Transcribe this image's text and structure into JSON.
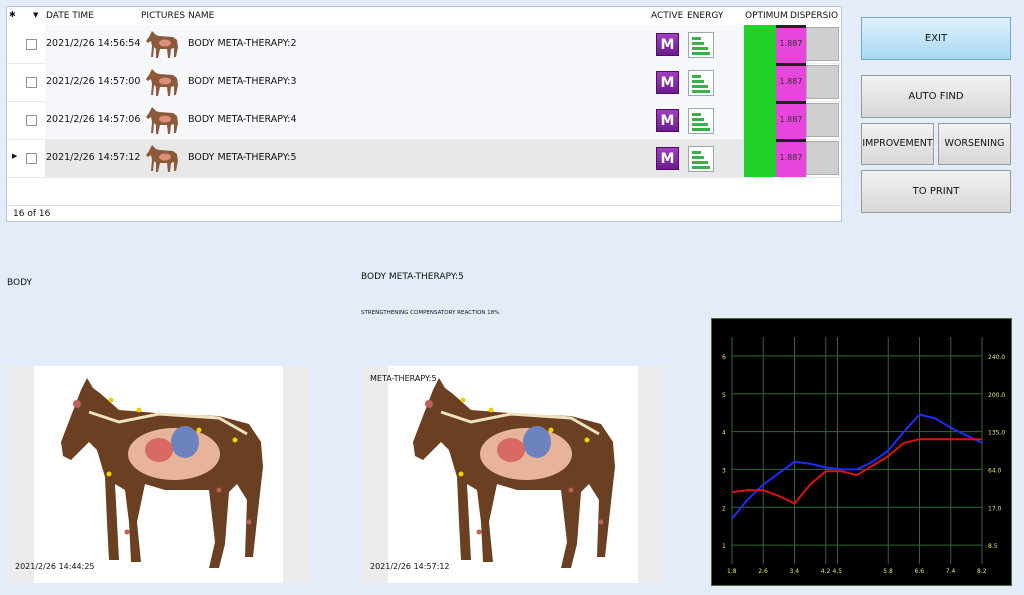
{
  "grid": {
    "headers": {
      "date_time": "DATE TIME",
      "pictures": "PICTURES",
      "name": "NAME",
      "active": "ACTIVE",
      "energy": "ENERGY",
      "optimum": "OPTIMUM",
      "dispersion": "DISPERSIO"
    },
    "rows": [
      {
        "date": "2021/2/26 14:56:54",
        "name": "BODY META-THERAPY:2",
        "active": "M",
        "dispersion": "1.887",
        "selected": false
      },
      {
        "date": "2021/2/26 14:57:00",
        "name": "BODY META-THERAPY:3",
        "active": "M",
        "dispersion": "1.887",
        "selected": false
      },
      {
        "date": "2021/2/26 14:57:06",
        "name": "BODY META-THERAPY:4",
        "active": "M",
        "dispersion": "1.887",
        "selected": false
      },
      {
        "date": "2021/2/26 14:57:12",
        "name": "BODY META-THERAPY:5",
        "active": "M",
        "dispersion": "1.887",
        "selected": true
      }
    ],
    "footer": "16 of 16"
  },
  "buttons": {
    "exit": "EXIT",
    "auto_find": "AUTO FIND",
    "improvement": "IMPROVEMENT",
    "worsening": "WORSENING",
    "to_print": "TO PRINT"
  },
  "panels": {
    "left_title": "BODY",
    "center_title": "BODY META-THERAPY:5",
    "center_subtitle": "STRENGTHENING COMPENSATORY REACTION 18%",
    "center_image_label": "META-THERAPY:5",
    "left_image_date": "2021/2/26 14:44:25",
    "center_image_date": "2021/2/26 14:57:12"
  },
  "colors": {
    "optimum": "#22d22a",
    "dispersion": "#e845dc",
    "active": "#8a2fb0",
    "curve_blue": "#1f2bff",
    "curve_red": "#e01010",
    "chart_grid": "#2f6a2f"
  },
  "chart_data": {
    "type": "line",
    "x_ticks": [
      "1.8",
      "2.6",
      "3.4",
      "4.2",
      "4.5",
      "5.8",
      "6.6",
      "7.4",
      "8.2"
    ],
    "y_left_ticks": [
      "6",
      "5",
      "4",
      "3",
      "2",
      "1"
    ],
    "y_right_ticks": [
      "240.0",
      "200.0",
      "135.0",
      "64.0",
      "17.0",
      "8.5"
    ],
    "series": [
      {
        "color": "blue",
        "x": [
          1.8,
          2.2,
          2.6,
          3.0,
          3.4,
          3.8,
          4.2,
          4.6,
          5.0,
          5.4,
          5.8,
          6.2,
          6.6,
          7.0,
          7.4,
          7.8,
          8.2
        ],
        "y": [
          1.7,
          2.2,
          2.6,
          2.9,
          3.2,
          3.15,
          3.05,
          3.0,
          3.0,
          3.2,
          3.5,
          4.0,
          4.45,
          4.35,
          4.1,
          3.9,
          3.7
        ]
      },
      {
        "color": "red",
        "x": [
          1.8,
          2.2,
          2.6,
          3.0,
          3.4,
          3.8,
          4.2,
          4.6,
          5.0,
          5.4,
          5.8,
          6.2,
          6.6,
          7.0,
          7.4,
          7.8,
          8.2
        ],
        "y": [
          2.4,
          2.45,
          2.45,
          2.3,
          2.1,
          2.6,
          2.95,
          2.95,
          2.85,
          3.1,
          3.35,
          3.7,
          3.8,
          3.8,
          3.8,
          3.8,
          3.8
        ]
      }
    ],
    "xlim": [
      1.8,
      8.2
    ],
    "ylim": [
      0.5,
      6.5
    ],
    "grid": true
  }
}
